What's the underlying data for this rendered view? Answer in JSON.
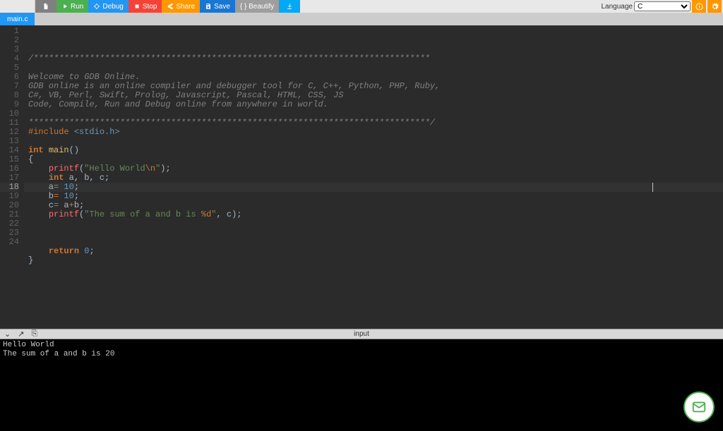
{
  "toolbar": {
    "run": "Run",
    "debug": "Debug",
    "stop": "Stop",
    "share": "Share",
    "save": "Save",
    "beautify": "{ } Beautify",
    "language_label": "Language",
    "language_value": "C"
  },
  "tabs": {
    "active": "main.c"
  },
  "code": {
    "lines": [
      {
        "n": 1,
        "t": "cmt",
        "text": "/******************************************************************************"
      },
      {
        "n": 2,
        "t": "cmt",
        "text": ""
      },
      {
        "n": 3,
        "t": "cmt",
        "text": "Welcome to GDB Online."
      },
      {
        "n": 4,
        "t": "cmt",
        "text": "GDB online is an online compiler and debugger tool for C, C++, Python, PHP, Ruby, "
      },
      {
        "n": 5,
        "t": "cmt",
        "text": "C#, VB, Perl, Swift, Prolog, Javascript, Pascal, HTML, CSS, JS"
      },
      {
        "n": 6,
        "t": "cmt",
        "text": "Code, Compile, Run and Debug online from anywhere in world."
      },
      {
        "n": 7,
        "t": "cmt",
        "text": ""
      },
      {
        "n": 8,
        "t": "cmt",
        "text": "*******************************************************************************/"
      },
      {
        "n": 9,
        "t": "pp",
        "text": "#include <stdio.h>"
      },
      {
        "n": 10,
        "t": "",
        "text": ""
      },
      {
        "n": 11,
        "t": "fn",
        "text": "int main()"
      },
      {
        "n": 12,
        "t": "",
        "text": "{"
      },
      {
        "n": 13,
        "t": "pf",
        "text": "    printf(\"Hello World\\n\");"
      },
      {
        "n": 14,
        "t": "decl",
        "text": "    int a, b, c;"
      },
      {
        "n": 15,
        "t": "asgn",
        "text": "    a= 10;"
      },
      {
        "n": 16,
        "t": "asgn",
        "text": "    b=10;"
      },
      {
        "n": 17,
        "t": "asgn2",
        "text": "    c= a+b;"
      },
      {
        "n": 18,
        "t": "pf2",
        "text": "    printf(\"The sum of a and b is %d\", c);"
      },
      {
        "n": 19,
        "t": "",
        "text": "    "
      },
      {
        "n": 20,
        "t": "",
        "text": ""
      },
      {
        "n": 21,
        "t": "",
        "text": ""
      },
      {
        "n": 22,
        "t": "ret",
        "text": "    return 0;"
      },
      {
        "n": 23,
        "t": "",
        "text": "}"
      },
      {
        "n": 24,
        "t": "",
        "text": ""
      }
    ],
    "active_line": 18
  },
  "splitter": {
    "center": "input"
  },
  "console": {
    "output": "Hello World\nThe sum of a and b is 20"
  }
}
